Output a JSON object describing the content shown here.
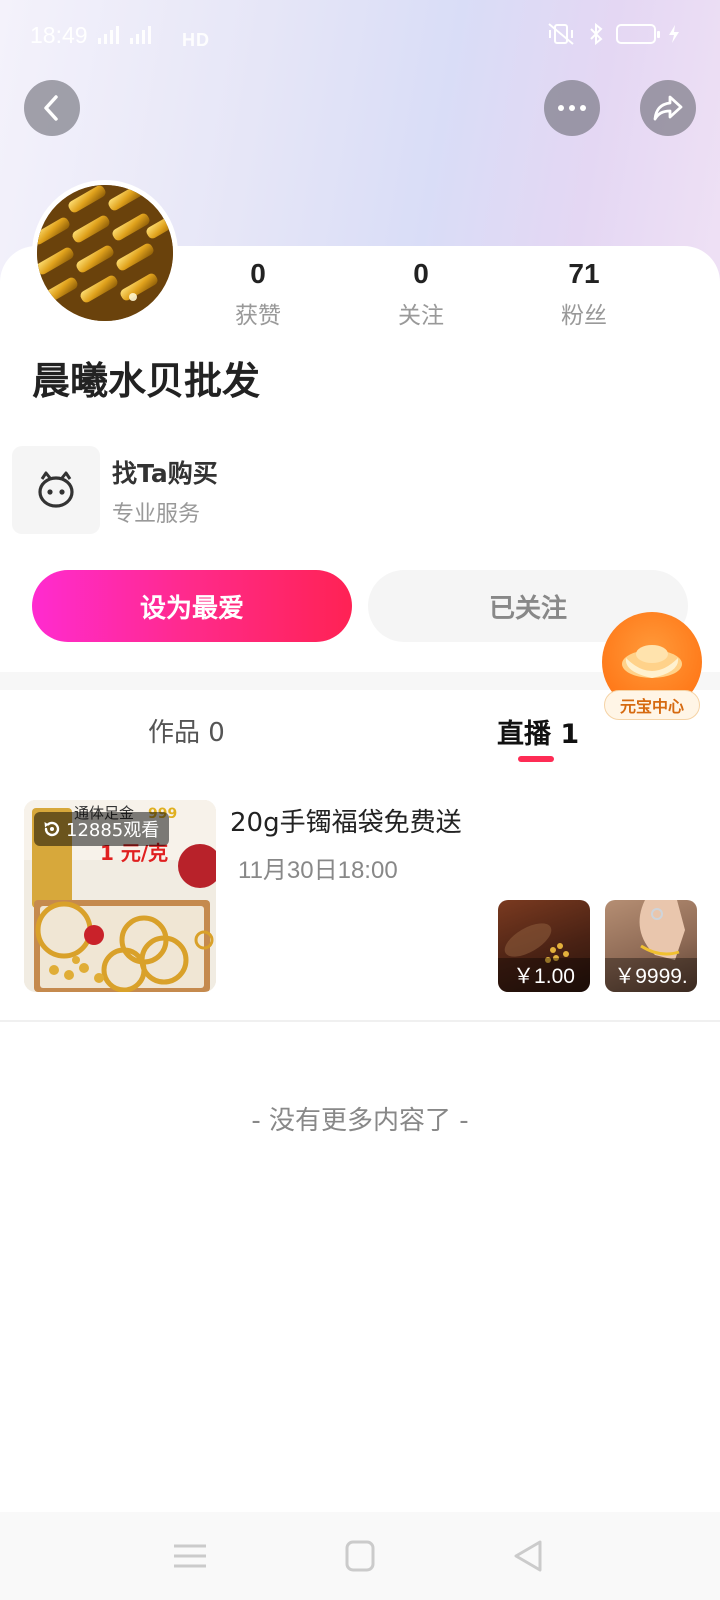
{
  "status_bar": {
    "time": "18:49",
    "network": "HD"
  },
  "profile": {
    "username": "晨曦水贝批发",
    "stats": [
      {
        "value": "0",
        "label": "获赞"
      },
      {
        "value": "0",
        "label": "关注"
      },
      {
        "value": "71",
        "label": "粉丝"
      }
    ]
  },
  "shop": {
    "title": "找Ta购买",
    "subtitle": "专业服务"
  },
  "actions": {
    "favorite_label": "设为最爱",
    "followed_label": "已关注"
  },
  "floating": {
    "yuanbao_label": "元宝中心"
  },
  "tabs": [
    {
      "label": "作品 0",
      "active": false
    },
    {
      "label": "直播 1",
      "active": true
    }
  ],
  "live_item": {
    "views": "12885观看",
    "title": "20g手镯福袋免费送",
    "time": "11月30日18:00",
    "thumb_texts": [
      "通体足金",
      "999",
      "1 元/克"
    ],
    "products": [
      {
        "price": "￥1.00"
      },
      {
        "price": "￥9999."
      }
    ]
  },
  "footer": {
    "no_more": "- 没有更多内容了 -"
  },
  "colors": {
    "accent": "#fe2c55",
    "fav_gradient_start": "#ff2bd0",
    "fav_gradient_end": "#ff2254",
    "yuanbao": "#ff7a1a"
  }
}
